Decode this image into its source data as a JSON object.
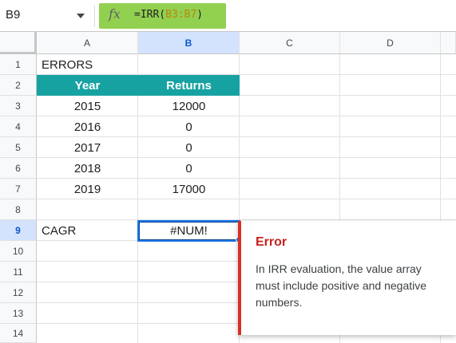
{
  "formula_bar": {
    "name_box": "B9",
    "fx_label": "fx",
    "formula_prefix": "=IRR(",
    "formula_range": "B3:B7",
    "formula_suffix": ")"
  },
  "columns": [
    "A",
    "B",
    "C",
    "D"
  ],
  "rows": [
    "1",
    "2",
    "3",
    "4",
    "5",
    "6",
    "7",
    "8",
    "9",
    "10",
    "11",
    "12",
    "13",
    "14"
  ],
  "cells": {
    "a1": "ERRORS",
    "a2": "Year",
    "b2": "Returns",
    "a3": "2015",
    "b3": "12000",
    "a4": "2016",
    "b4": "0",
    "a5": "2017",
    "b5": "0",
    "a6": "2018",
    "b6": "0",
    "a7": "2019",
    "b7": "17000",
    "a9": "CAGR",
    "b9": "#NUM!"
  },
  "error_popup": {
    "title": "Error",
    "message": "In IRR evaluation, the value array must include positive and negative numbers."
  },
  "colors": {
    "formula_highlight": "#92d050",
    "table_header": "#17a2a2",
    "selection": "#1a73e8",
    "error_accent": "#d93025"
  }
}
